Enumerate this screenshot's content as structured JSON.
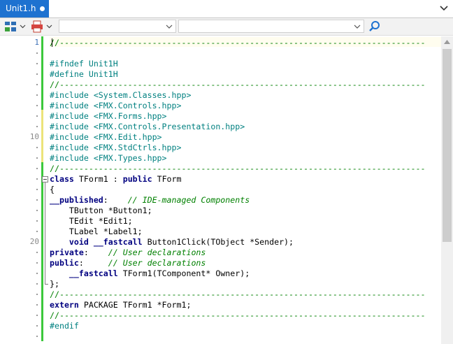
{
  "tab": {
    "title": "Unit1.h",
    "modified_indicator": "dot-icon"
  },
  "toolbar": {
    "combo1_value": "",
    "combo2_value": ""
  },
  "colors": {
    "tab_bg": "#1e72d0",
    "keyword": "#000080",
    "preprocessor": "#008080",
    "comment": "#008000"
  },
  "gutter": {
    "line_numbers": [
      "1",
      "10",
      "20"
    ]
  },
  "code": {
    "lines": [
      "//---------------------------------------------------------------------------",
      "",
      "#ifndef Unit1H",
      "#define Unit1H",
      "//---------------------------------------------------------------------------",
      "#include <System.Classes.hpp>",
      "#include <FMX.Controls.hpp>",
      "#include <FMX.Forms.hpp>",
      "#include <FMX.Controls.Presentation.hpp>",
      "#include <FMX.Edit.hpp>",
      "#include <FMX.StdCtrls.hpp>",
      "#include <FMX.Types.hpp>",
      "//---------------------------------------------------------------------------",
      "class TForm1 : public TForm",
      "{",
      "__published:    // IDE-managed Components",
      "    TButton *Button1;",
      "    TEdit *Edit1;",
      "    TLabel *Label1;",
      "    void __fastcall Button1Click(TObject *Sender);",
      "private:    // User declarations",
      "public:     // User declarations",
      "    __fastcall TForm1(TComponent* Owner);",
      "};",
      "//---------------------------------------------------------------------------",
      "extern PACKAGE TForm1 *Form1;",
      "//---------------------------------------------------------------------------",
      "#endif"
    ]
  }
}
